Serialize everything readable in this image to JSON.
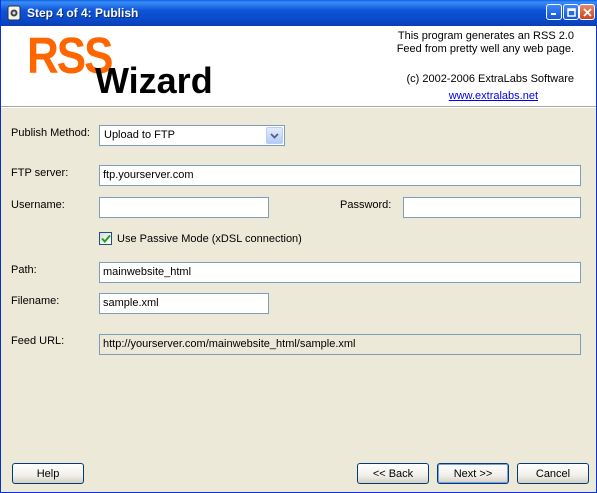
{
  "window": {
    "title": "Step 4 of 4: Publish"
  },
  "header": {
    "logo_top": "RSS",
    "logo_bottom": "Wizard",
    "description_line1": "This program generates an RSS 2.0",
    "description_line2": "Feed from pretty well any web page.",
    "copyright": "(c) 2002-2006 ExtraLabs Software",
    "website": "www.extralabs.net"
  },
  "form": {
    "publish_method": {
      "label": "Publish Method:",
      "value": "Upload to FTP"
    },
    "ftp_server": {
      "label": "FTP server:",
      "value": "ftp.yourserver.com"
    },
    "username": {
      "label": "Username:",
      "value": ""
    },
    "password": {
      "label": "Password:",
      "value": ""
    },
    "passive_mode": {
      "label": "Use Passive Mode (xDSL connection)",
      "checked": true
    },
    "path": {
      "label": "Path:",
      "value": "mainwebsite_html"
    },
    "filename": {
      "label": "Filename:",
      "value": "sample.xml"
    },
    "feed_url": {
      "label": "Feed URL:",
      "value": "http://yourserver.com/mainwebsite_html/sample.xml"
    }
  },
  "buttons": {
    "help": "Help",
    "back": "<< Back",
    "next": "Next >>",
    "cancel": "Cancel"
  },
  "colors": {
    "logo_orange": "#ff6600",
    "titlebar_blue": "#0a4ccc",
    "dialog_bg": "#ece9d8"
  }
}
